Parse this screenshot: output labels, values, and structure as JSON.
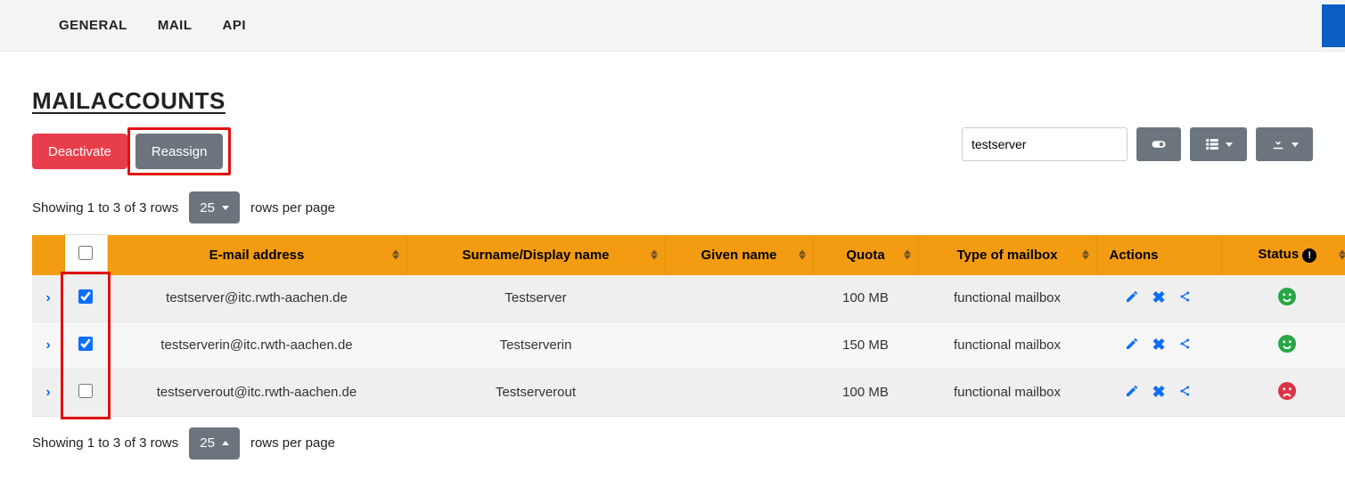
{
  "tabs": {
    "general": "GENERAL",
    "mail": "MAIL",
    "api": "API"
  },
  "page": {
    "title": "MAILACCOUNTS"
  },
  "buttons": {
    "deactivate": "Deactivate",
    "reassign": "Reassign"
  },
  "search": {
    "value": "testserver"
  },
  "pagination": {
    "showing_text": "Showing 1 to 3 of 3 rows",
    "page_size": "25",
    "rows_label": "rows per page"
  },
  "columns": {
    "email": "E-mail address",
    "surname": "Surname/Display name",
    "given": "Given name",
    "quota": "Quota",
    "type": "Type of mailbox",
    "actions": "Actions",
    "status": "Status"
  },
  "rows": [
    {
      "checked": true,
      "email": "testserver@itc.rwth-aachen.de",
      "surname": "Testserver",
      "given": "",
      "quota": "100 MB",
      "type": "functional mailbox",
      "status": "ok"
    },
    {
      "checked": true,
      "email": "testserverin@itc.rwth-aachen.de",
      "surname": "Testserverin",
      "given": "",
      "quota": "150 MB",
      "type": "functional mailbox",
      "status": "ok"
    },
    {
      "checked": false,
      "email": "testserverout@itc.rwth-aachen.de",
      "surname": "Testserverout",
      "given": "",
      "quota": "100 MB",
      "type": "functional mailbox",
      "status": "bad"
    }
  ]
}
